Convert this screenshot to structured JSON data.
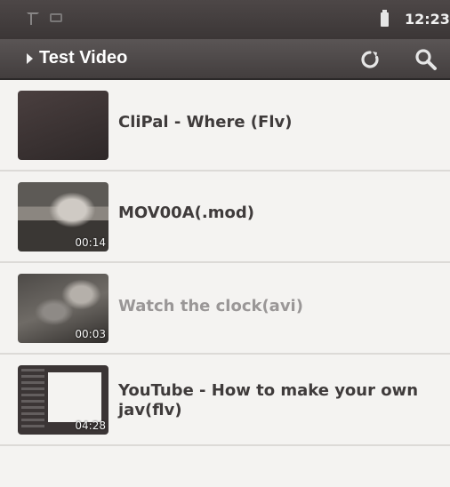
{
  "status_bar": {
    "time": "12:23",
    "icons": [
      "signal-icon",
      "usb-icon",
      "battery-icon"
    ]
  },
  "title_bar": {
    "title": "Test Video",
    "actions": [
      "refresh-icon",
      "search-icon"
    ]
  },
  "videos": [
    {
      "title": "CliPal - Where (Flv)",
      "duration": "",
      "dimmed": false
    },
    {
      "title": "MOV00A(.mod)",
      "duration": "00:14",
      "dimmed": false
    },
    {
      "title": "Watch the clock(avi)",
      "duration": "00:03",
      "dimmed": true
    },
    {
      "title": "YouTube - How to make your own jav(flv)",
      "duration": "04:28",
      "dimmed": false
    }
  ],
  "colors": {
    "status_bar_bg": "#3b3636",
    "title_bar_bg": "#4e4949",
    "list_bg": "#f4f3f1",
    "title_text": "#3f3b3b",
    "dimmed_text": "#9a9797"
  }
}
